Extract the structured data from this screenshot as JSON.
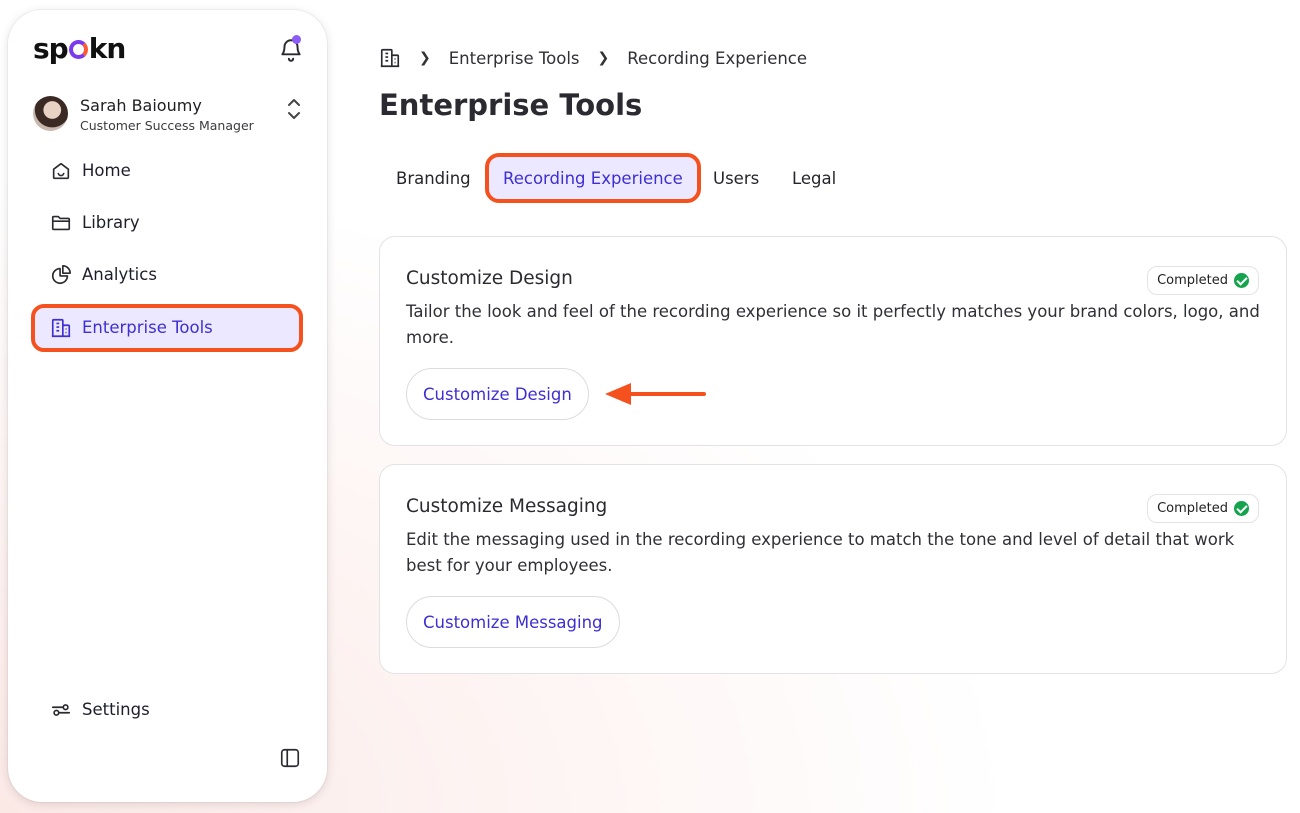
{
  "brand": {
    "logo_text_1": "sp",
    "logo_text_2": "kn",
    "accent": "#3d2fd1",
    "highlight": "#f4511e"
  },
  "user": {
    "name": "Sarah Baioumy",
    "role": "Customer Success Manager"
  },
  "nav": {
    "items": [
      {
        "label": "Home",
        "icon": "home-icon"
      },
      {
        "label": "Library",
        "icon": "folder-icon"
      },
      {
        "label": "Analytics",
        "icon": "pie-chart-icon"
      },
      {
        "label": "Enterprise Tools",
        "icon": "building-icon",
        "active": true
      }
    ],
    "settings_label": "Settings"
  },
  "breadcrumb": {
    "items": [
      "Enterprise Tools",
      "Recording Experience"
    ]
  },
  "page": {
    "title": "Enterprise Tools"
  },
  "tabs": [
    {
      "label": "Branding"
    },
    {
      "label": "Recording Experience",
      "active": true
    },
    {
      "label": "Users"
    },
    {
      "label": "Legal"
    }
  ],
  "cards": [
    {
      "title": "Customize Design",
      "status": "Completed",
      "description": "Tailor the look and feel of the recording experience so it perfectly matches your brand colors, logo, and more.",
      "button_label": "Customize Design"
    },
    {
      "title": "Customize Messaging",
      "status": "Completed",
      "description": "Edit the messaging used in the recording experience to match the tone and level of detail that work best for your employees.",
      "button_label": "Customize Messaging"
    }
  ]
}
